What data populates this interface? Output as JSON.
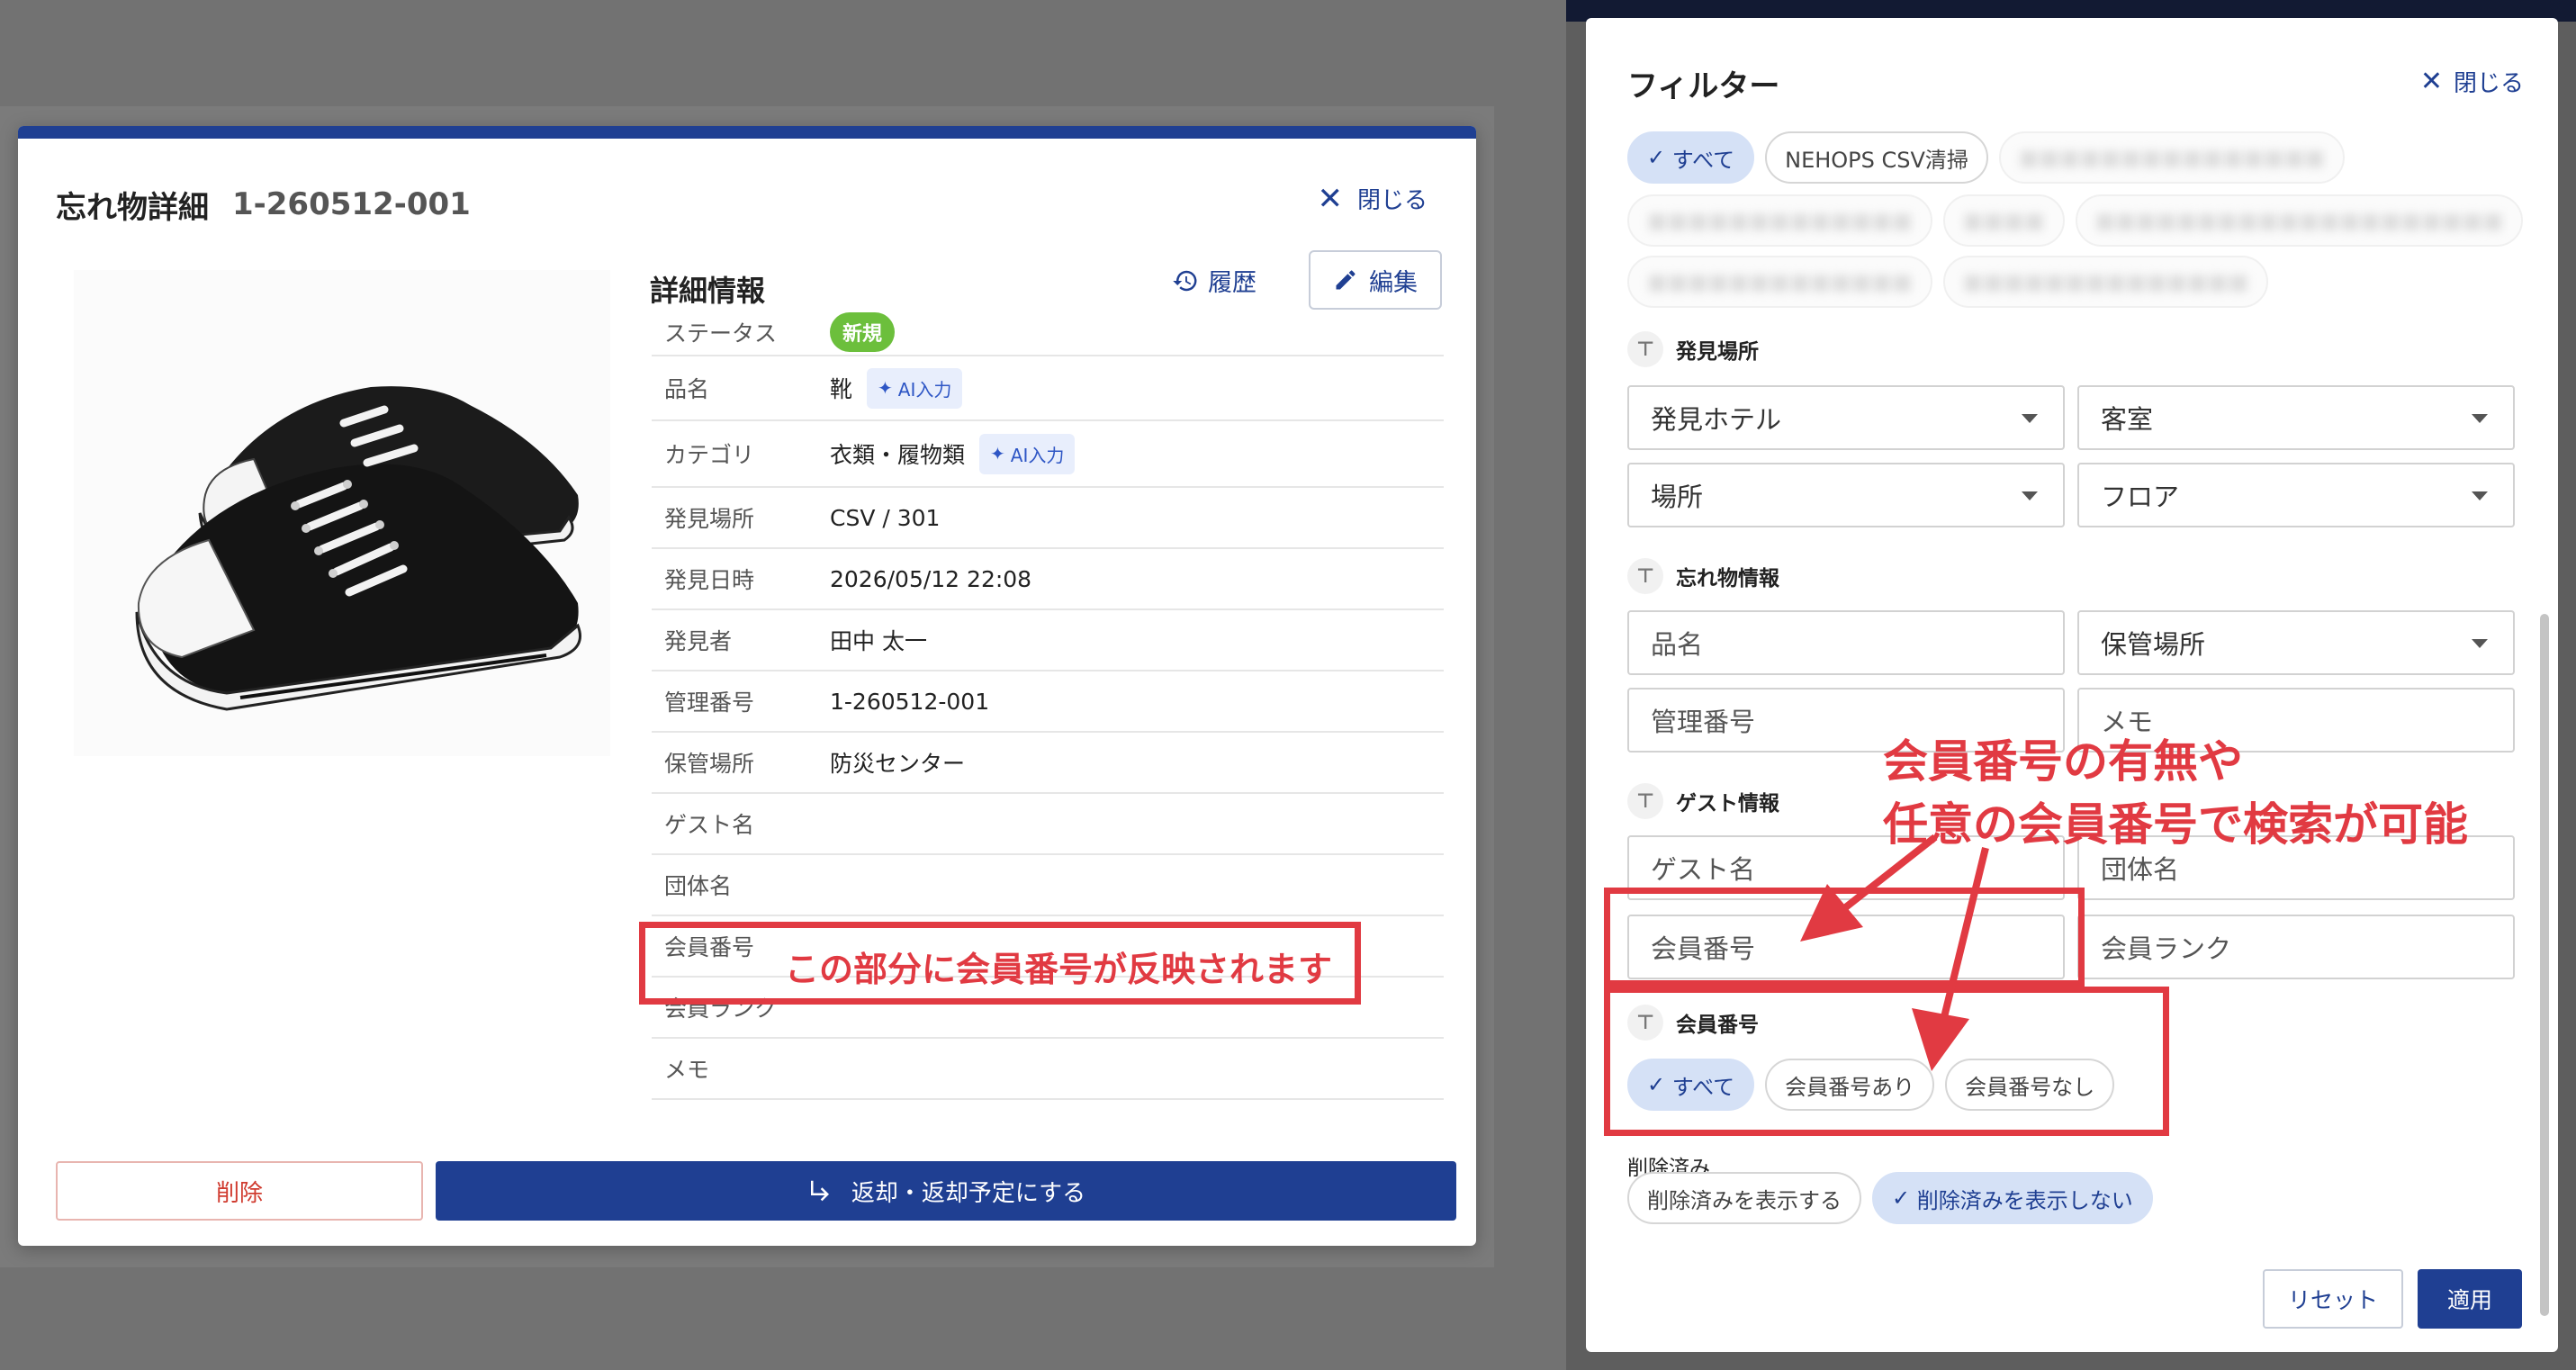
{
  "detail_modal": {
    "title": "忘れ物詳細",
    "id": "1-260512-001",
    "close_label": "閉じる",
    "section_title": "詳細情報",
    "history_label": "履歴",
    "edit_label": "編集",
    "rows": [
      {
        "key": "ステータス",
        "value": "新規"
      },
      {
        "key": "品名",
        "value": "靴",
        "ai": "AI入力"
      },
      {
        "key": "カテゴリ",
        "value": "衣類・履物類",
        "ai": "AI入力"
      },
      {
        "key": "発見場所",
        "value": "CSV / 301"
      },
      {
        "key": "発見日時",
        "value": "2026/05/12 22:08"
      },
      {
        "key": "発見者",
        "value": "田中 太一"
      },
      {
        "key": "管理番号",
        "value": "1-260512-001"
      },
      {
        "key": "保管場所",
        "value": "防災センター"
      },
      {
        "key": "ゲスト名",
        "value": ""
      },
      {
        "key": "団体名",
        "value": ""
      },
      {
        "key": "会員番号",
        "value": ""
      },
      {
        "key": "会員ランク",
        "value": ""
      },
      {
        "key": "メモ",
        "value": ""
      }
    ],
    "delete_label": "削除",
    "return_label": "返却・返却予定にする"
  },
  "filter": {
    "title": "フィルター",
    "close_label": "閉じる",
    "source_chips": [
      "すべて",
      "NEHOPS CSV清掃"
    ],
    "sections": {
      "location": "発見場所",
      "item_info": "忘れ物情報",
      "guest_info": "ゲスト情報",
      "member_no": "会員番号"
    },
    "fields": {
      "hotel": "発見ホテル",
      "room": "客室",
      "place": "場所",
      "floor": "フロア",
      "item_name": "品名",
      "storage": "保管場所",
      "mgmt_no": "管理番号",
      "memo": "メモ",
      "guest_name": "ゲスト名",
      "group_name": "団体名",
      "member_no": "会員番号",
      "member_rank": "会員ランク"
    },
    "member_chips": [
      "すべて",
      "会員番号あり",
      "会員番号なし"
    ],
    "deleted_label": "削除済み",
    "deleted_chips": [
      "削除済みを表示する",
      "削除済みを表示しない"
    ],
    "reset_label": "リセット",
    "apply_label": "適用"
  },
  "annotations": {
    "left": "この部分に会員番号が反映されます",
    "right_line1": "会員番号の有無や",
    "right_line2": "任意の会員番号で検索が可能"
  },
  "colors": {
    "primary": "#1f3f92",
    "annotation": "#e13a42",
    "status_new": "#6cbf3c"
  }
}
